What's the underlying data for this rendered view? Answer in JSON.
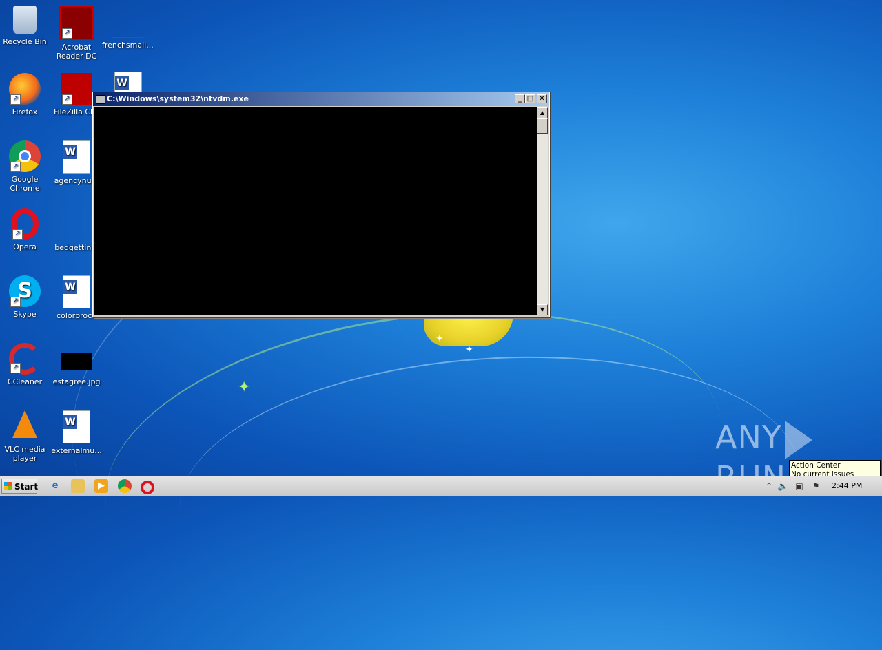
{
  "desktop": {
    "icons": [
      {
        "label": "Recycle Bin",
        "icon": "recycle-bin-icon"
      },
      {
        "label": "Acrobat Reader DC",
        "icon": "acrobat-icon"
      },
      {
        "label": "frenchsmall....",
        "icon": "file-icon"
      },
      {
        "label": "Firefox",
        "icon": "firefox-icon"
      },
      {
        "label": "FileZilla Clie",
        "icon": "filezilla-icon"
      },
      {
        "label": "Google Chrome",
        "icon": "chrome-icon"
      },
      {
        "label": "agencynum",
        "icon": "word-doc-icon"
      },
      {
        "label": "Opera",
        "icon": "opera-icon"
      },
      {
        "label": "bedgetting.",
        "icon": "file-icon"
      },
      {
        "label": "Skype",
        "icon": "skype-icon"
      },
      {
        "label": "colorproce",
        "icon": "word-doc-icon"
      },
      {
        "label": "CCleaner",
        "icon": "ccleaner-icon"
      },
      {
        "label": "estagree.jpg",
        "icon": "image-file-icon"
      },
      {
        "label": "VLC media player",
        "icon": "vlc-icon"
      },
      {
        "label": "externalmu...",
        "icon": "word-doc-icon"
      }
    ]
  },
  "window": {
    "title": "C:\\Windows\\system32\\ntvdm.exe",
    "minimize": "_",
    "maximize": "□",
    "close": "✕"
  },
  "taskbar": {
    "start_label": "Start",
    "apps": [
      "internet-explorer-icon",
      "explorer-folder-icon",
      "media-player-icon",
      "chrome-icon",
      "opera-icon"
    ],
    "clock": "2:44 PM"
  },
  "tooltip": {
    "title": "Action Center",
    "body": "No current issues detected"
  },
  "watermark": {
    "left": "ANY",
    "right": "RUN"
  }
}
